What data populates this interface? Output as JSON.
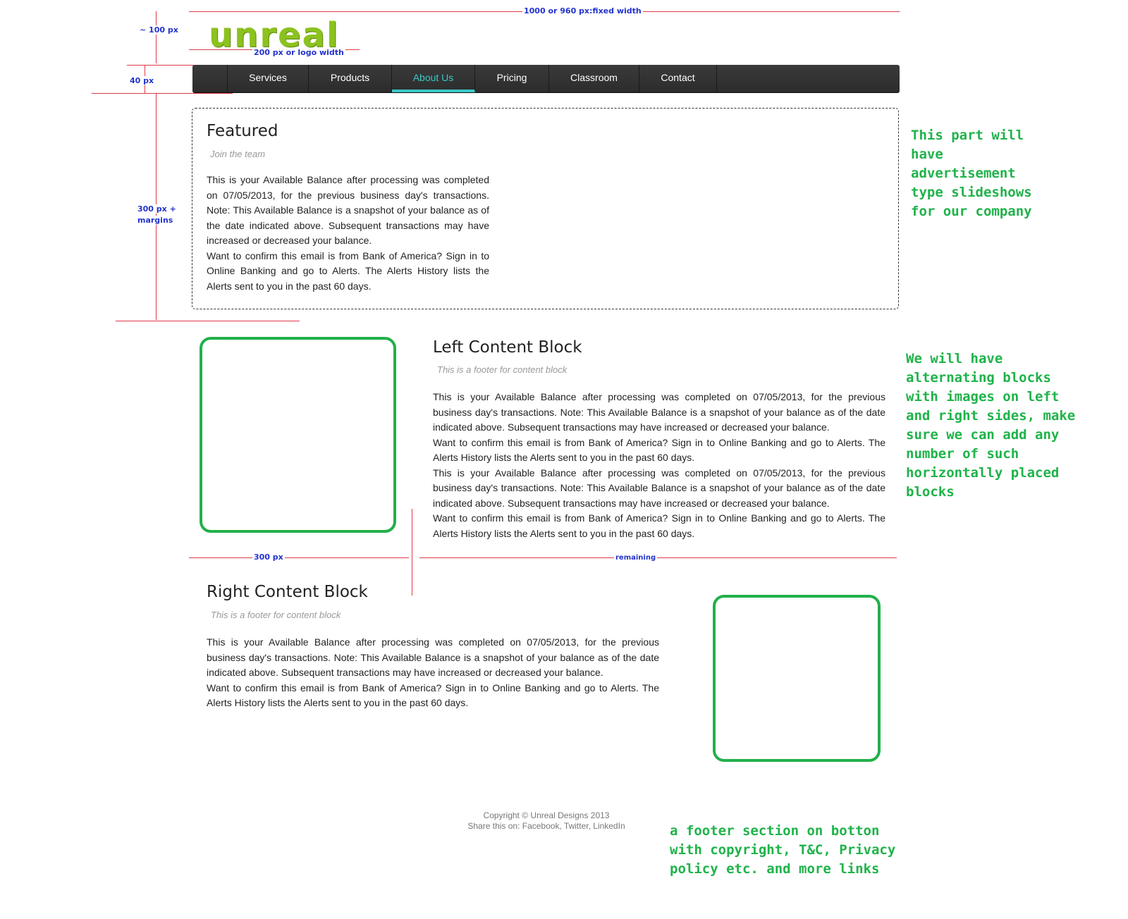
{
  "annotations": {
    "fixed_width": "1000 or 960 px:fixed width",
    "header_height": "~ 100 px",
    "logo_width": "200 px or logo width",
    "nav_height": "40 px",
    "featured_height_line1": "300 px +",
    "featured_height_line2": "margins",
    "image_width": "300 px",
    "remaining": "remaining",
    "featured_note": "This part will have advertisement type slideshows for our company",
    "blocks_note": "We will have alternating blocks with images on left and right sides, make sure we can add any number of such horizontally placed blocks",
    "footer_note": "a footer section on botton with copyright, T&C, Privacy policy etc. and more links"
  },
  "logo": {
    "text": "unreal"
  },
  "nav": {
    "items": [
      {
        "label": "Services"
      },
      {
        "label": "Products"
      },
      {
        "label": "About Us",
        "active": true
      },
      {
        "label": "Pricing"
      },
      {
        "label": "Classroom"
      },
      {
        "label": "Contact"
      }
    ]
  },
  "featured": {
    "title": "Featured",
    "subtitle": "Join the team",
    "para1": "This is your Available Balance after processing was completed on 07/05/2013, for the previous business day's transactions. Note: This Available Balance is a snapshot of your balance as of the date indicated above. Subsequent transactions may have increased or decreased your balance.",
    "para2": "Want to confirm this email is from Bank of America? Sign in to Online Banking and go to Alerts. The Alerts History lists the Alerts sent to you in the past 60 days."
  },
  "left_block": {
    "title": "Left Content Block",
    "subtitle": "This is a footer for content block",
    "para1": "This is your Available Balance after processing was completed on 07/05/2013, for the previous business day's transactions. Note: This Available Balance is a snapshot of your balance as of the date indicated above. Subsequent transactions may have increased or decreased your balance.",
    "para2": "Want to confirm this email is from Bank of America? Sign in to Online Banking and go to Alerts. The Alerts History lists the Alerts sent to you in the past 60 days.",
    "para3": "This is your Available Balance after processing was completed on 07/05/2013, for the previous business day's transactions. Note: This Available Balance is a snapshot of your balance as of the date indicated above. Subsequent transactions may have increased or decreased your balance.",
    "para4": "Want to confirm this email is from Bank of America? Sign in to Online Banking and go to Alerts. The Alerts History lists the Alerts sent to you in the past 60 days."
  },
  "right_block": {
    "title": "Right Content Block",
    "subtitle": "This is a footer for content block",
    "para1": "This is your Available Balance after processing was completed on 07/05/2013, for the previous business day's transactions. Note: This Available Balance is a snapshot of your balance as of the date indicated above. Subsequent transactions may have increased or decreased your balance.",
    "para2": "Want to confirm this email is from Bank of America? Sign in to Online Banking and go to Alerts. The Alerts History lists the Alerts sent to you in the past 60 days."
  },
  "footer": {
    "copyright": "Copyright © Unreal Designs 2013",
    "share": "Share this on: Facebook, Twitter, LinkedIn"
  },
  "colors": {
    "annotation_line": "#e03a4a",
    "annotation_text": "#2233cc",
    "note_text": "#1fb34a",
    "nav_bg": "#333333",
    "nav_active": "#3cc8c8",
    "image_placeholder_border": "#22b04b",
    "logo": "#8cc21f"
  }
}
